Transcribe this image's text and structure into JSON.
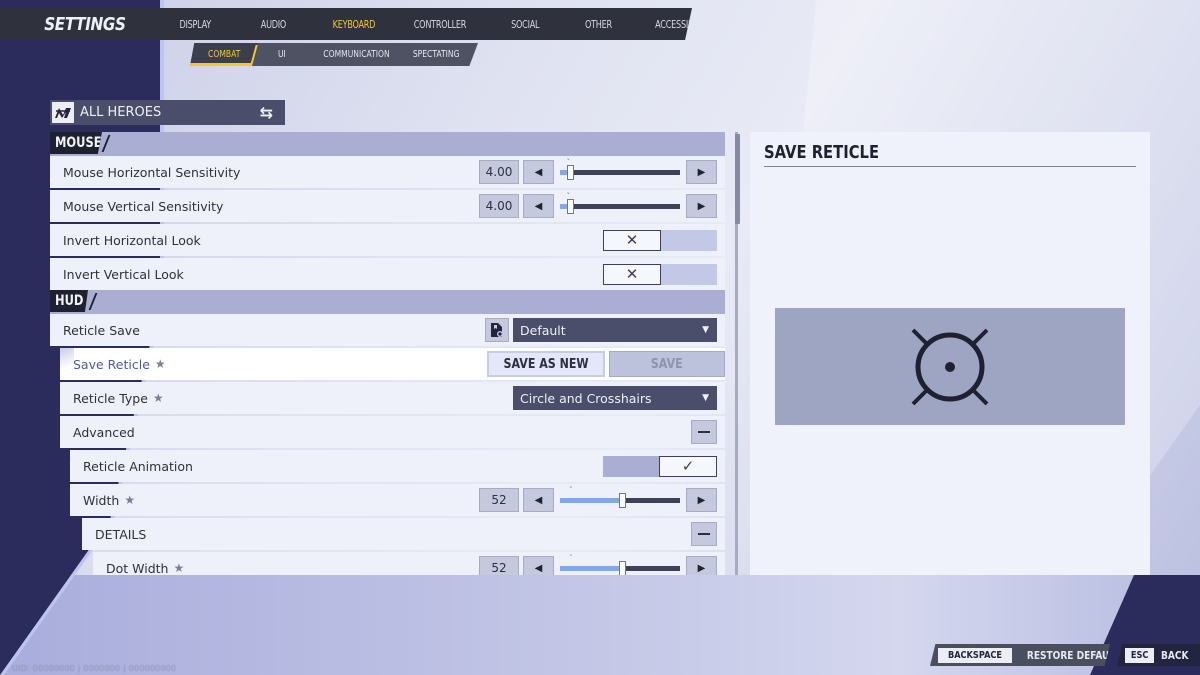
{
  "header": {
    "title": "SETTINGS",
    "tabs": [
      {
        "label": "DISPLAY",
        "active": false
      },
      {
        "label": "AUDIO",
        "active": false
      },
      {
        "label": "KEYBOARD",
        "active": true
      },
      {
        "label": "CONTROLLER",
        "active": false
      },
      {
        "label": "SOCIAL",
        "active": false
      },
      {
        "label": "OTHER",
        "active": false
      },
      {
        "label": "ACCESSIBILITY",
        "active": false
      }
    ],
    "subtabs": [
      {
        "label": "COMBAT",
        "active": true
      },
      {
        "label": "UI",
        "active": false
      },
      {
        "label": "COMMUNICATION",
        "active": false
      },
      {
        "label": "SPECTATING",
        "active": false
      }
    ]
  },
  "hero_selector": {
    "label": "ALL HEROES",
    "icon": "hero-logo-icon",
    "action_icon": "swap-arrows-icon"
  },
  "sections": {
    "mouse": {
      "title": "MOUSE",
      "rows": [
        {
          "label": "Mouse Horizontal Sensitivity",
          "value": "4.00",
          "slider_fraction": 0.08
        },
        {
          "label": "Mouse Vertical Sensitivity",
          "value": "4.00",
          "slider_fraction": 0.08
        },
        {
          "label": "Invert Horizontal Look",
          "toggle": "off"
        },
        {
          "label": "Invert Vertical Look",
          "toggle": "off"
        }
      ]
    },
    "hud": {
      "title": "HUD",
      "rows": {
        "reticle_save": {
          "label": "Reticle Save",
          "dropdown": "Default",
          "icon": "save-file-icon"
        },
        "save_reticle": {
          "label": "Save Reticle",
          "starred": true,
          "save_as_new": "SAVE AS NEW",
          "save": "SAVE"
        },
        "reticle_type": {
          "label": "Reticle Type",
          "starred": true,
          "dropdown": "Circle and Crosshairs"
        },
        "advanced": {
          "label": "Advanced",
          "expanded": true
        },
        "reticle_animation": {
          "label": "Reticle Animation",
          "toggle": "on"
        },
        "width": {
          "label": "Width",
          "starred": true,
          "value": "52",
          "slider_fraction": 0.52
        },
        "details": {
          "label": "DETAILS",
          "expanded": true
        },
        "dot_width": {
          "label": "Dot Width",
          "starred": true,
          "value": "52",
          "slider_fraction": 0.52
        }
      }
    }
  },
  "preview": {
    "title": "SAVE RETICLE",
    "reticle": "circle-crosshair-dot-reticle"
  },
  "footer": {
    "restore": {
      "key": "BACKSPACE",
      "label": "RESTORE DEFAULTS"
    },
    "back": {
      "key": "ESC",
      "label": "BACK"
    },
    "uid": "UID: 00000000 | 0000000 | 000000000"
  },
  "colors": {
    "accent": "#f2c933",
    "panel_dark": "#4b4e6a",
    "highlight_text": "#4c5aa0"
  }
}
